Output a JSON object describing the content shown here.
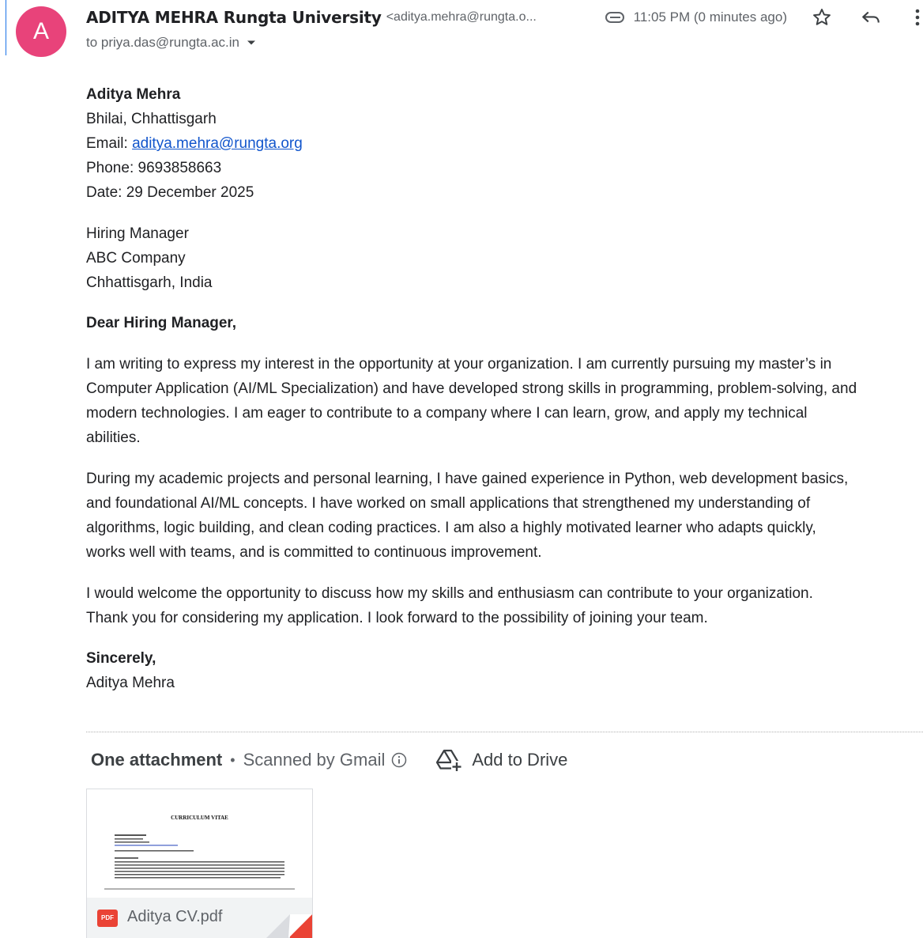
{
  "header": {
    "avatar_letter": "A",
    "sender_name": "ADITYA MEHRA Rungta University",
    "sender_email": "<aditya.mehra@rungta.o...",
    "time": "11:05 PM (0 minutes ago)",
    "recipient": "to priya.das@rungta.ac.in"
  },
  "letter": {
    "sender_block": {
      "name": "Aditya Mehra",
      "location": "Bhilai, Chhattisgarh",
      "email_label": "Email:",
      "email": "aditya.mehra@rungta.org",
      "phone": "Phone: 9693858663",
      "date": "Date: 29 December 2025"
    },
    "recipient_block": {
      "title": "Hiring Manager",
      "company": "ABC Company",
      "location": "Chhattisgarh, India"
    },
    "salutation": "Dear Hiring Manager,",
    "paragraph1": {
      "line1": "I am writing to express my interest in the opportunity at your organization. I am currently pursuing my master’s in",
      "line2": "Computer Application (AI/ML Specialization) and have developed strong skills in programming, problem-solving, and",
      "line3": "modern technologies. I am eager to contribute to a company where I can learn, grow, and apply my technical",
      "line4": "abilities."
    },
    "paragraph2": {
      "line1": "During my academic projects and personal learning, I have gained experience in Python, web development basics,",
      "line2": "and foundational AI/ML concepts. I have worked on small applications that strengthened my understanding of",
      "line3": "algorithms, logic building, and clean coding practices. I am also a highly motivated learner who adapts quickly,",
      "line4": "works well with teams, and is committed to continuous improvement."
    },
    "paragraph3": {
      "line1": "I would welcome the opportunity to discuss how my skills and enthusiasm can contribute to your organization.",
      "line2": "Thank you for considering my application. I look forward to the possibility of joining your team."
    },
    "closing": "Sincerely,",
    "signature": "Aditya Mehra"
  },
  "attachments": {
    "title": "One attachment",
    "separator": "•",
    "scanned": "Scanned by Gmail",
    "add_to_drive": "Add to Drive",
    "file": {
      "name": "Aditya CV.pdf",
      "badge": "PDF",
      "thumbnail_heading": "CURRICULUM VITAE"
    }
  },
  "colors": {
    "avatar": "#e8437a",
    "link": "#1155cc",
    "pdf_badge": "#ea4335",
    "accent_rule": "#1a73e8"
  },
  "icons": [
    "label-icon",
    "star-icon",
    "reply-icon",
    "more-vert-icon",
    "caret-down-icon",
    "info-icon",
    "add-to-drive-icon",
    "pdf-icon"
  ]
}
